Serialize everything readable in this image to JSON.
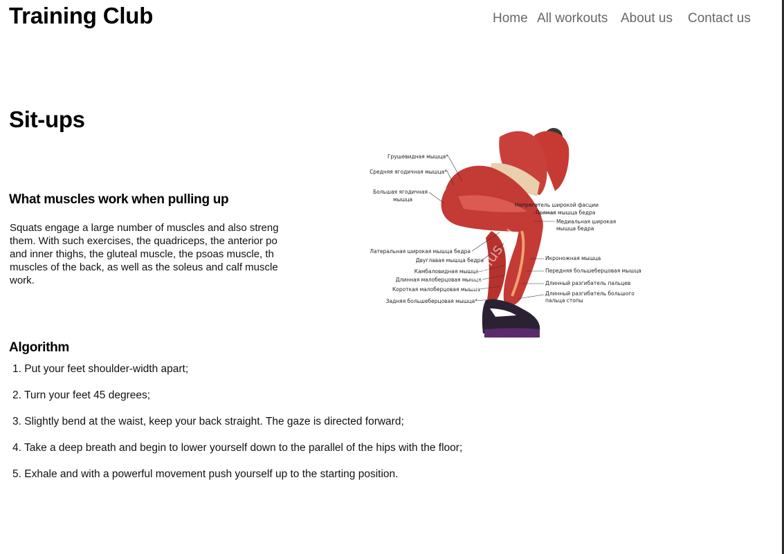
{
  "header": {
    "logo": "Training Club",
    "nav": [
      {
        "label": "Home"
      },
      {
        "label": "All workouts"
      },
      {
        "label": "About us"
      },
      {
        "label": "Contact us"
      }
    ]
  },
  "main": {
    "title": "Sit-ups",
    "muscles": {
      "heading": "What muscles work when pulling up",
      "lines": [
        "Squats engage a large number of muscles and also streng",
        "them. With such exercises, the quadriceps, the anterior po",
        "and inner thighs, the gluteal muscle, the psoas muscle, th",
        "muscles of the back, as well as the soleus and calf muscle",
        "work."
      ]
    },
    "illustration": {
      "labels_left": [
        "Грушевидная мышца*",
        "Средняя ягодичная мышца*",
        "Большая ягодичная",
        "мышца",
        "Латеральная широкая мышца бедра",
        "Двуглавая мышца бедра",
        "Камбаловидная мышца",
        "Длинная малоберцовая мышца",
        "Короткая малоберцовая мышца",
        "Задняя большеберцовая мышца*"
      ],
      "labels_right": [
        "Напрягатель широкой фасции",
        "Прямая мышца бедра",
        "Медиальная широкая",
        "мышца бедра",
        "Икроножная мышца",
        "Передняя большеберцовая мышца",
        "Длинный разгибатель пальцев",
        "Длинный разгибатель большого",
        "пальца стопы"
      ],
      "watermark": "gtonus.ru"
    },
    "algorithm": {
      "heading": "Algorithm",
      "steps": [
        "1. Put your feet shoulder-width apart;",
        "2. Turn your feet 45 degrees;",
        "3. Slightly bend at the waist, keep your back straight. The gaze is directed forward;",
        "4. Take a deep breath and begin to lower yourself down to the parallel of the hips with the floor;",
        "5. Exhale and with a powerful movement push yourself up to the starting position."
      ]
    }
  }
}
